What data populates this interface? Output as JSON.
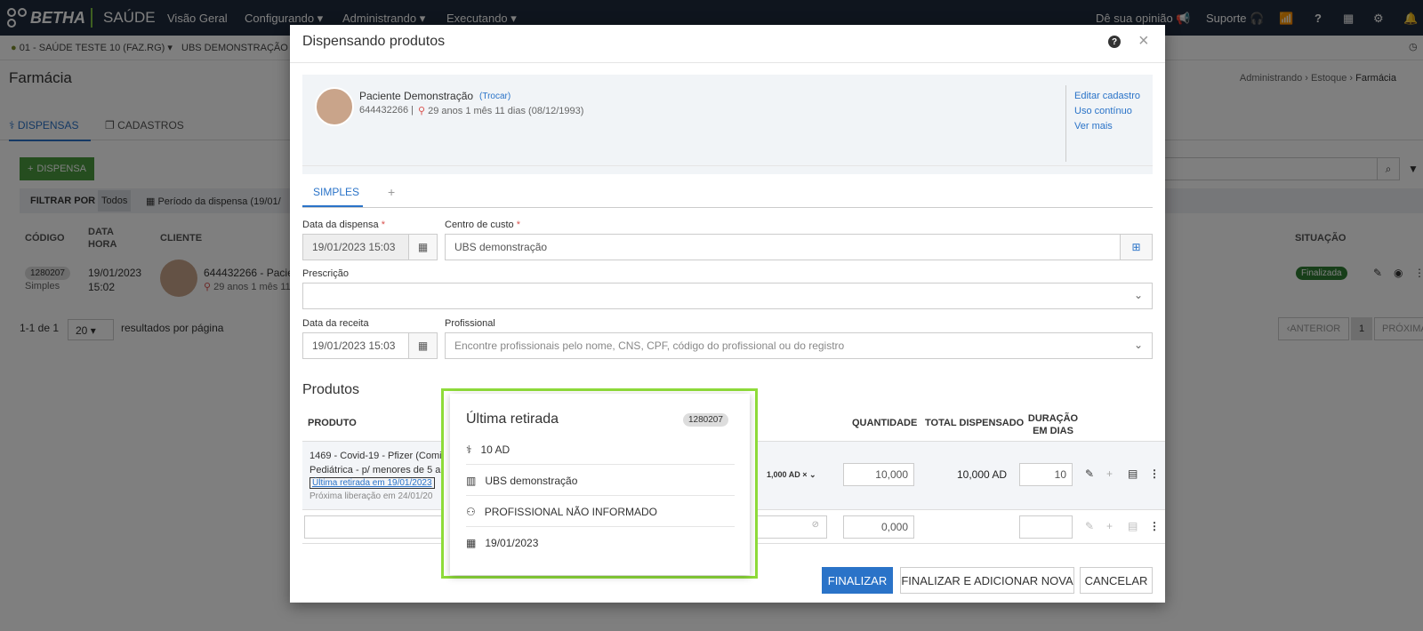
{
  "topbar": {
    "brand": "BETHA",
    "app": "SAÚDE",
    "nav": [
      "Visão Geral",
      "Configurando",
      "Administrando",
      "Executando"
    ],
    "feedback": "Dê sua opinião",
    "support": "Suporte"
  },
  "subbar": {
    "entity": "01 - SAÚDE TESTE 10 (FAZ.RG)",
    "unit": "UBS DEMONSTRAÇÃO"
  },
  "page": {
    "title": "Farmácia",
    "breadcrumb": [
      "Administrando",
      "Estoque",
      "Farmácia"
    ],
    "tabs": [
      "DISPENSAS",
      "CADASTROS"
    ],
    "add_button": "DISPENSA",
    "filter_label": "FILTRAR POR",
    "filter_all": "Todos",
    "filter_period": "Período da dispensa (19/01/",
    "columns": [
      "CÓDIGO",
      "DATA HORA",
      "CLIENTE",
      "SITUAÇÃO"
    ],
    "row": {
      "code": "1280207",
      "type": "Simples",
      "date": "19/01/2023",
      "time": "15:02",
      "client": "644432266 - Pacien",
      "client_age": "29 anos 1 mês 11",
      "status": "Finalizada"
    },
    "pagination": {
      "range": "1-1 de 1",
      "per_page": "20",
      "per_page_label": "resultados por página",
      "prev": "ANTERIOR",
      "page": "1",
      "next": "PRÓXIMA"
    }
  },
  "modal": {
    "title": "Dispensando produtos",
    "patient": {
      "name": "Paciente Demonstração",
      "swap": "(Trocar)",
      "id": "644432266 |",
      "age": "29 anos 1 mês 11 dias (08/12/1993)",
      "links": [
        "Editar cadastro",
        "Uso contínuo",
        "Ver mais"
      ]
    },
    "tabs": {
      "simple": "SIMPLES",
      "add": "+"
    },
    "fields": {
      "dispense_date_label": "Data da dispensa",
      "dispense_date_value": "19/01/2023 15:03",
      "cost_center_label": "Centro de custo",
      "cost_center_value": "UBS demonstração",
      "prescription_label": "Prescrição",
      "prescription_value": "",
      "recipe_date_label": "Data da receita",
      "recipe_date_value": "19/01/2023 15:03",
      "professional_label": "Profissional",
      "professional_placeholder": "Encontre profissionais pelo nome, CNS, CPF, código do profissional ou do registro"
    },
    "products": {
      "title": "Produtos",
      "headers": {
        "product": "PRODUTO",
        "quantity": "QUANTIDADE",
        "total": "TOTAL DISPENSADO",
        "duration": "DURAÇÃO EM DIAS"
      },
      "row1": {
        "name_line1": "1469 - Covid-19 - Pfizer (Comi",
        "name_line2": "Pediátrica - p/ menores de 5 a",
        "last_withdrawal_link": "Última retirada em 19/01/2023",
        "next_release": "Próxima liberação em 24/01/20",
        "unit": "1,000 AD",
        "quantity": "10,000",
        "total": "10,000 AD",
        "duration": "10"
      },
      "row2": {
        "quantity": "0,000",
        "duration": ""
      }
    },
    "buttons": {
      "finalize": "FINALIZAR",
      "finalize_add": "FINALIZAR E ADICIONAR NOVA",
      "cancel": "CANCELAR"
    }
  },
  "popover": {
    "title": "Última retirada",
    "code": "1280207",
    "quantity": "10 AD",
    "unit": "UBS demonstração",
    "professional": "PROFISSIONAL NÃO INFORMADO",
    "date": "19/01/2023"
  }
}
